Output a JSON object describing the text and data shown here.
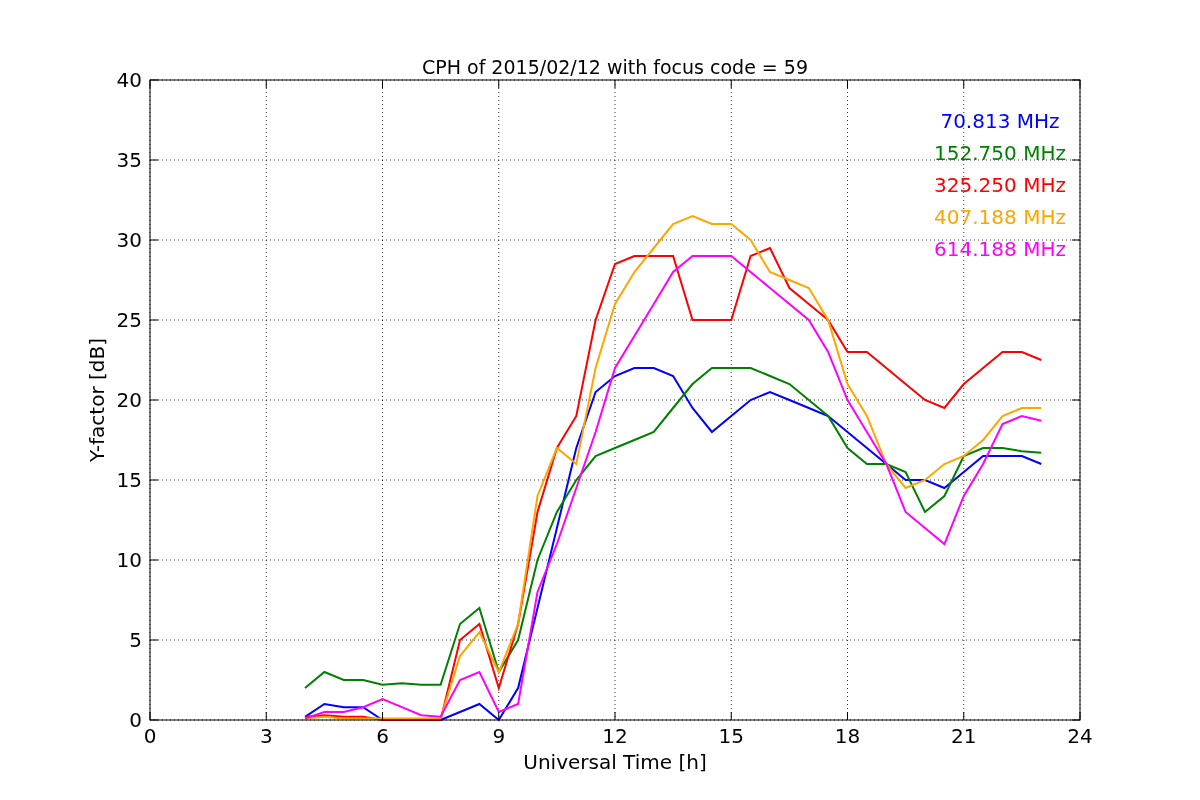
{
  "chart_data": {
    "type": "line",
    "title": "CPH of 2015/02/12 with focus code = 59",
    "xlabel": "Universal Time [h]",
    "ylabel": "Y-factor [dB]",
    "xlim": [
      0,
      24
    ],
    "ylim": [
      0,
      40
    ],
    "grid": true,
    "xticks": [
      0,
      3,
      6,
      9,
      12,
      15,
      18,
      21,
      24
    ],
    "yticks": [
      0,
      5,
      10,
      15,
      20,
      25,
      30,
      35,
      40
    ],
    "x": [
      4,
      4.5,
      5,
      5.5,
      6,
      6.5,
      7,
      7.5,
      8,
      8.5,
      9,
      9.5,
      10,
      10.5,
      11,
      11.5,
      12,
      12.5,
      13,
      13.5,
      14,
      14.5,
      15,
      15.5,
      16,
      16.5,
      17,
      17.5,
      18,
      18.5,
      19,
      19.5,
      20,
      20.5,
      21,
      21.5,
      22,
      22.5,
      23
    ],
    "series": [
      {
        "name": "70.813 MHz",
        "color": "#0000ff",
        "values": [
          0.2,
          1,
          0.8,
          0.8,
          0,
          0,
          0,
          0,
          0.5,
          1,
          0,
          2,
          7,
          12,
          17,
          20.5,
          21.5,
          22,
          22,
          21.5,
          19.5,
          18,
          19,
          20,
          20.5,
          20,
          19.5,
          19,
          18,
          17,
          16,
          15,
          15,
          14.5,
          15.5,
          16.5,
          16.5,
          16.5,
          16
        ]
      },
      {
        "name": "152.750 MHz",
        "color": "#008000",
        "values": [
          2,
          3,
          2.5,
          2.5,
          2.2,
          2.3,
          2.2,
          2.2,
          6,
          7,
          3,
          5,
          10,
          13,
          15,
          16.5,
          17,
          17.5,
          18,
          19.5,
          21,
          22,
          22,
          22,
          21.5,
          21,
          20,
          19,
          17,
          16,
          16,
          15.5,
          13,
          14,
          16.5,
          17,
          17,
          16.8,
          16.7
        ]
      },
      {
        "name": "325.250 MHz",
        "color": "#ff0000",
        "values": [
          0.2,
          0.3,
          0.2,
          0.2,
          0,
          0,
          0,
          0,
          5,
          6,
          2,
          6,
          13,
          17,
          19,
          25,
          28.5,
          29,
          29,
          29,
          25,
          25,
          25,
          29,
          29.5,
          27,
          26,
          25,
          23,
          23,
          22,
          21,
          20,
          19.5,
          21,
          22,
          23,
          23,
          22.5
        ]
      },
      {
        "name": "407.188 MHz",
        "color": "#ffa500",
        "values": [
          0.1,
          0.2,
          0.1,
          0.1,
          0.1,
          0.1,
          0.1,
          0.1,
          4,
          5.5,
          3,
          6,
          14,
          17,
          16,
          22,
          26,
          28,
          29.5,
          31,
          31.5,
          31,
          31,
          30,
          28,
          27.5,
          27,
          25,
          21,
          19,
          16,
          14.5,
          15,
          16,
          16.5,
          17.5,
          19,
          19.5,
          19.5
        ]
      },
      {
        "name": "614.188 MHz",
        "color": "#ff00ff",
        "values": [
          0.1,
          0.5,
          0.5,
          0.8,
          1.3,
          0.8,
          0.3,
          0.2,
          2.5,
          3,
          0.5,
          1,
          8,
          11,
          14.5,
          18,
          22,
          24,
          26,
          28,
          29,
          29,
          29,
          28,
          27,
          26,
          25,
          23,
          20,
          18,
          16,
          13,
          12,
          11,
          14,
          16,
          18.5,
          19,
          18.7
        ]
      }
    ]
  }
}
